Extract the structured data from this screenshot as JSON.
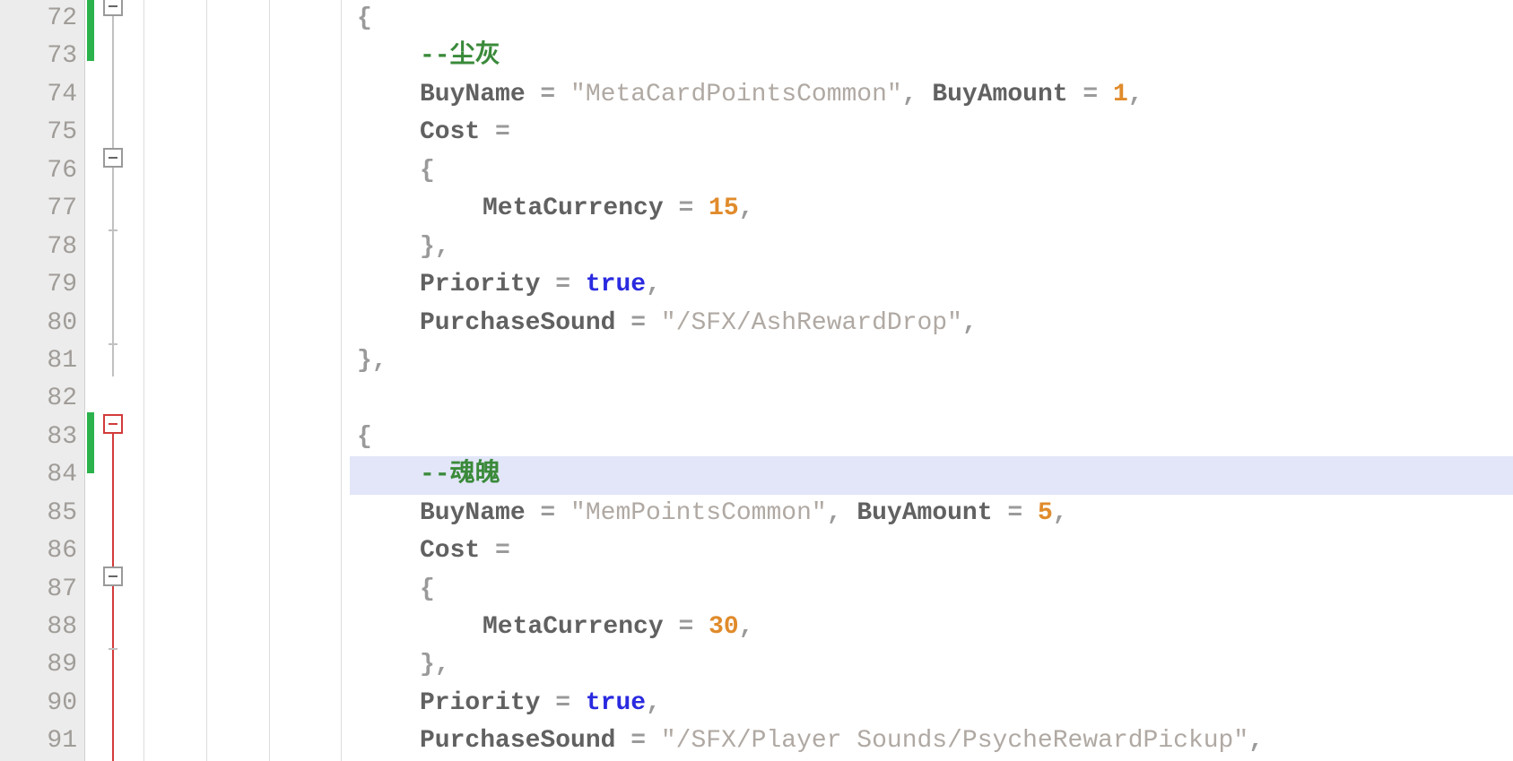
{
  "lineNumbers": [
    "72",
    "73",
    "74",
    "75",
    "76",
    "77",
    "78",
    "79",
    "80",
    "81",
    "82",
    "83",
    "84",
    "85",
    "86",
    "87",
    "88",
    "89",
    "90",
    "91"
  ],
  "code": {
    "l72": {
      "brace": "{"
    },
    "l73": {
      "cmt": "--尘灰"
    },
    "l74": {
      "buyName": "BuyName",
      "eq": " = ",
      "str": "\"MetaCardPointsCommon\"",
      "comma": ", ",
      "buyAmount": "BuyAmount",
      "eq2": " = ",
      "num": "1",
      "tail": ","
    },
    "l75": {
      "cost": "Cost",
      "eq": " ="
    },
    "l76": {
      "brace": "{"
    },
    "l77": {
      "meta": "MetaCurrency",
      "eq": " = ",
      "num": "15",
      "tail": ","
    },
    "l78": {
      "brace": "},"
    },
    "l79": {
      "prio": "Priority",
      "eq": " = ",
      "kw": "true",
      "tail": ","
    },
    "l80": {
      "ps": "PurchaseSound",
      "eq": " = ",
      "str": "\"/SFX/AshRewardDrop\"",
      "tail": ","
    },
    "l81": {
      "brace": "},"
    },
    "l82": {
      "empty": ""
    },
    "l83": {
      "brace": "{"
    },
    "l84": {
      "cmt": "--魂魄"
    },
    "l85": {
      "buyName": "BuyName",
      "eq": " = ",
      "str": "\"MemPointsCommon\"",
      "comma": ", ",
      "buyAmount": "BuyAmount",
      "eq2": " = ",
      "num": "5",
      "tail": ","
    },
    "l86": {
      "cost": "Cost",
      "eq": " ="
    },
    "l87": {
      "brace": "{"
    },
    "l88": {
      "meta": "MetaCurrency",
      "eq": " = ",
      "num": "30",
      "tail": ","
    },
    "l89": {
      "brace": "},"
    },
    "l90": {
      "prio": "Priority",
      "eq": " = ",
      "kw": "true",
      "tail": ","
    },
    "l91": {
      "ps": "PurchaseSound",
      "eq": " = ",
      "str": "\"/SFX/Player Sounds/PsycheRewardPickup\"",
      "tail": ","
    }
  },
  "chart_data": {
    "type": "table",
    "title": "Lua store entries",
    "entries": [
      {
        "comment": "尘灰",
        "BuyName": "MetaCardPointsCommon",
        "BuyAmount": 1,
        "Cost": {
          "MetaCurrency": 15
        },
        "Priority": true,
        "PurchaseSound": "/SFX/AshRewardDrop"
      },
      {
        "comment": "魂魄",
        "BuyName": "MemPointsCommon",
        "BuyAmount": 5,
        "Cost": {
          "MetaCurrency": 30
        },
        "Priority": true,
        "PurchaseSound": "/SFX/Player Sounds/PsycheRewardPickup"
      }
    ]
  }
}
